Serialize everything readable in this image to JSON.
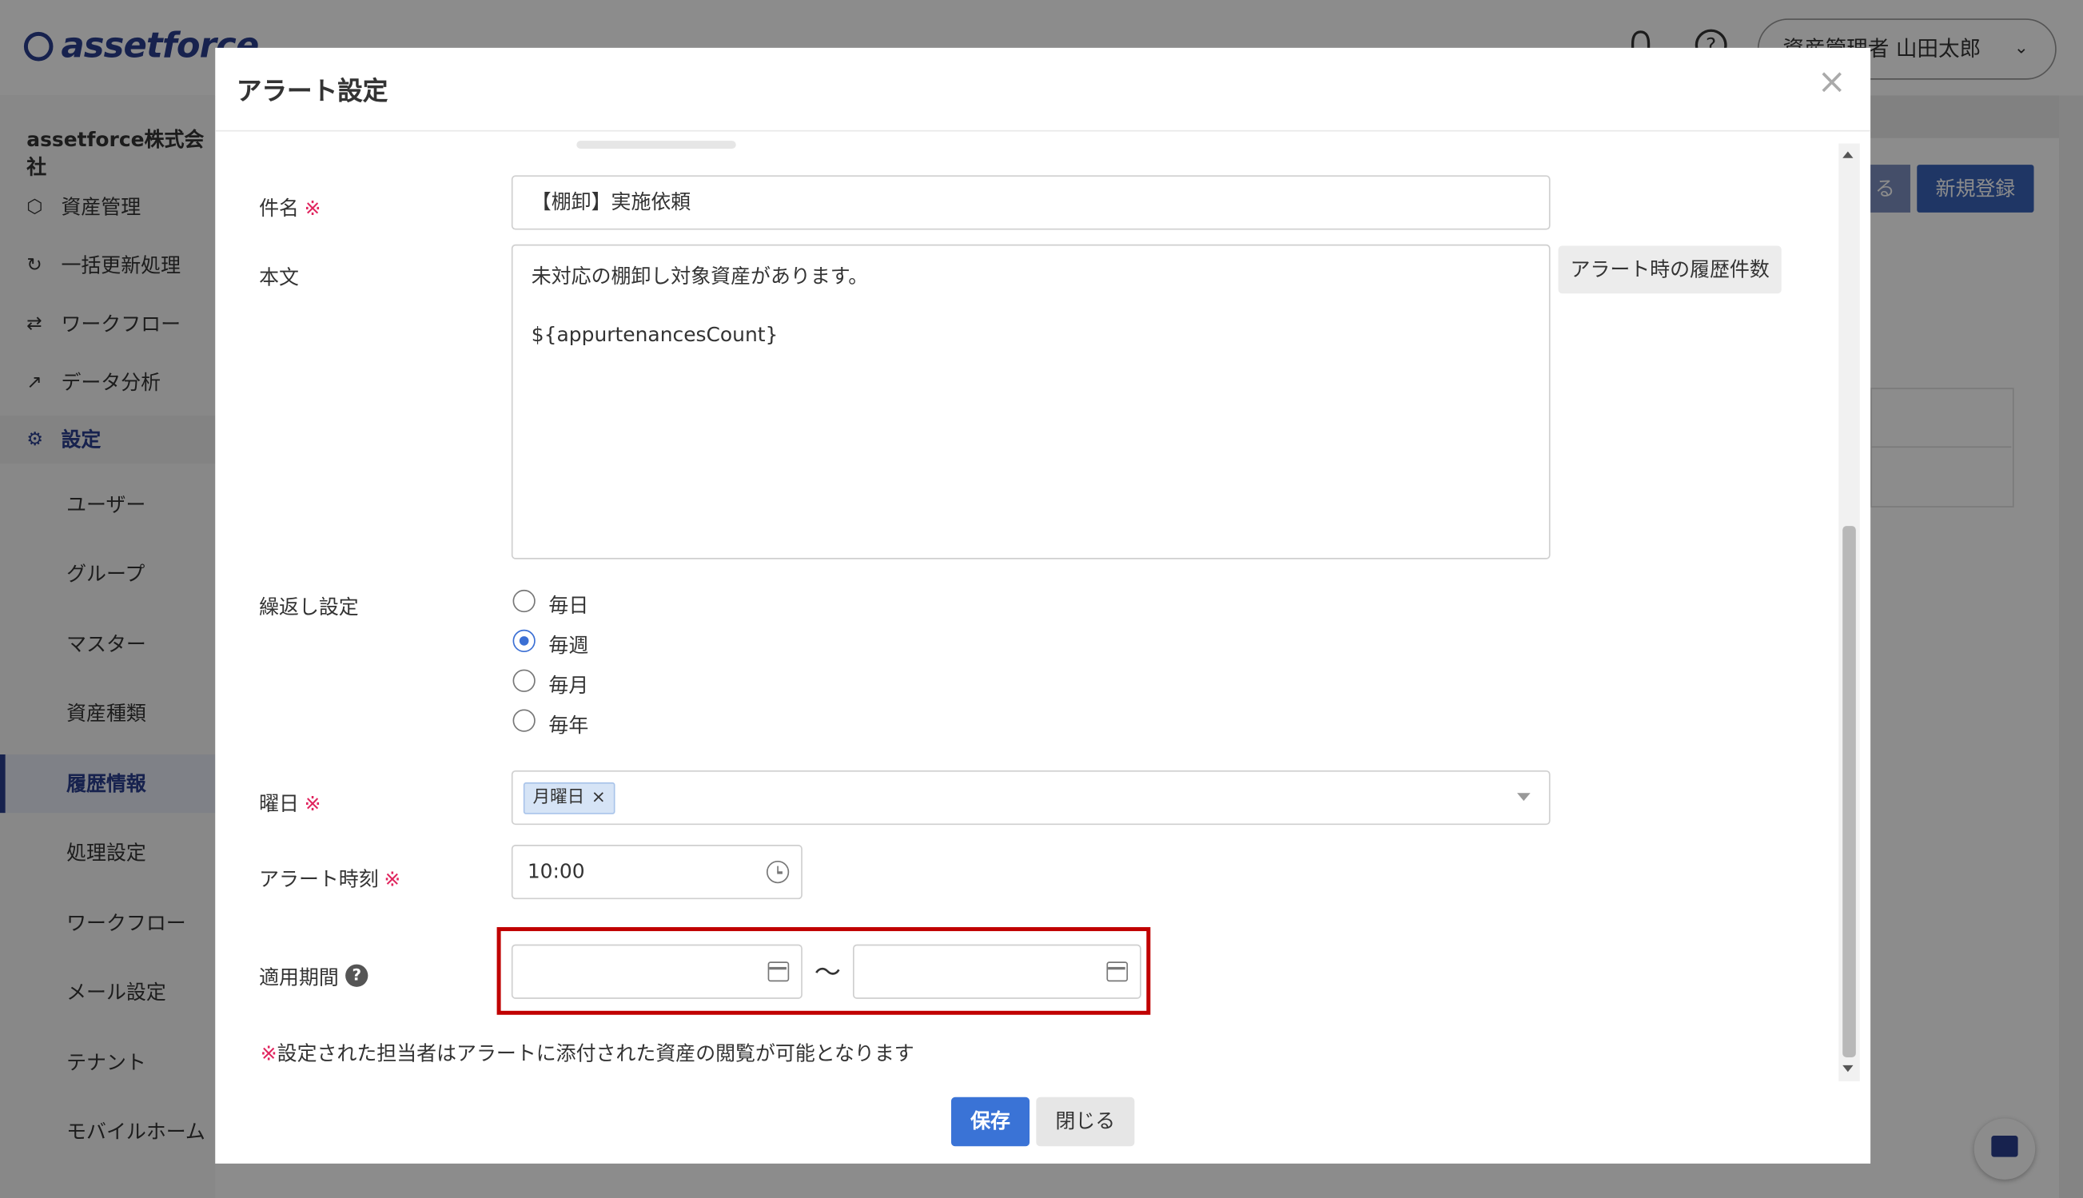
{
  "app": {
    "logo": "assetforce",
    "user_menu": "資産管理者 山田太郎",
    "company": "assetforce株式会社",
    "nav": [
      {
        "icon": "cube-icon",
        "label": "資産管理"
      },
      {
        "icon": "refresh-icon",
        "label": "一括更新処理"
      },
      {
        "icon": "workflow-icon",
        "label": "ワークフロー"
      },
      {
        "icon": "chart-icon",
        "label": "データ分析"
      },
      {
        "icon": "gear-icon",
        "label": "設定"
      }
    ],
    "settings_sub": [
      "ユーザー",
      "グループ",
      "マスター",
      "資産種類",
      "履歴情報",
      "処理設定",
      "ワークフロー",
      "メール設定",
      "テナント",
      "モバイルホーム"
    ],
    "active_sub": "履歴情報",
    "header_buttons": [
      "る",
      "新規登録"
    ]
  },
  "modal": {
    "title": "アラート設定",
    "subject_label": "件名",
    "subject_value": "【棚卸】実施依頼",
    "body_label": "本文",
    "body_line1": "未対応の棚卸し対象資産があります。",
    "body_line2": "${appurtenancesCount}",
    "insert_button": "アラート時の履歴件数",
    "repeat_label": "繰返し設定",
    "repeat_options": [
      "毎日",
      "毎週",
      "毎月",
      "毎年"
    ],
    "repeat_selected": "毎週",
    "weekday_label": "曜日",
    "weekday_tag": "月曜日",
    "time_label": "アラート時刻",
    "time_value": "10:00",
    "period_label": "適用期間",
    "period_start": "",
    "period_end": "",
    "period_separator": "〜",
    "required_mark": "※",
    "note_mark": "※",
    "note_text": "設定された担当者はアラートに添付された資産の閲覧が可能となります",
    "save_button": "保存",
    "close_button": "閉じる"
  }
}
